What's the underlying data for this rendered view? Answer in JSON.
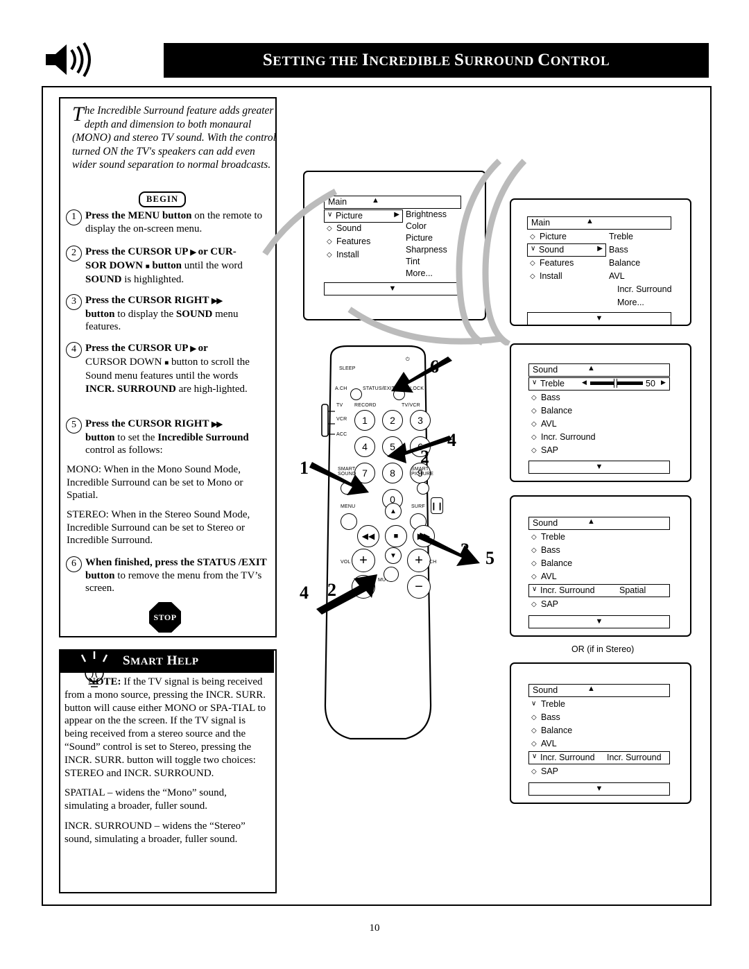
{
  "header": {
    "title_main": "SETTING THE INCREDIBLE SURROUND CONTROL",
    "speaker_icon": "speaker-icon"
  },
  "intro": {
    "dropcap": "T",
    "text": "he Incredible Surround feature adds greater depth and dimension to both monaural (MONO) and stereo TV sound. With the control turned ON the TV's speakers can add even wider sound separation to normal broadcasts."
  },
  "begin_label": "BEGIN",
  "stop_label": "STOP",
  "steps": [
    {
      "num": "1",
      "html": "<b>Press the MENU button</b> on the remote to display the on-screen menu."
    },
    {
      "num": "2",
      "html": "<b>Press the CURSOR UP ▶ or CUR-SOR DOWN ■ button</b> until the word <b>SOUND</b> is highlighted."
    },
    {
      "num": "3",
      "html": "<b>Press the CURSOR RIGHT ▶▶ button</b> to display the <b>SOUND</b> menu features."
    },
    {
      "num": "4",
      "html": "<b>Press the CURSOR UP ▶ or</b> CURSOR DOWN ■ button to scroll the Sound menu features until the words <b>INCR. SURROUND</b> are high-lighted."
    },
    {
      "num": "5",
      "html": "<b>Press the CURSOR RIGHT ▶▶ button</b> to set the <b>Incredible Surround</b> control as follows:"
    },
    {
      "num": "6",
      "html": "<b>When finished, press the STATUS /EXIT button</b> to remove the menu from the TV’s screen."
    }
  ],
  "paragraphs": [
    "MONO: When in the Mono Sound Mode, Incredible Surround can be set to Mono or Spatial.",
    "STEREO: When in the Stereo Sound Mode, Incredible Surround can be set to Stereo or Incredible Surround."
  ],
  "smart_help": {
    "title": "SMART HELP",
    "bulb_icon": "lightbulb-icon",
    "note_label": "NOTE:",
    "note": "If the TV signal is being received from a mono source, pressing the INCR. SURR. button will cause either MONO or SPA-TIAL to appear on the the screen. If the TV signal is being received from a stereo source and the “Sound” control is set to Stereo, pressing the INCR. SURR. button will toggle two choices: STEREO and  INCR. SURROUND.",
    "spatial": "SPATIAL – widens the “Mono” sound, simulating a broader, fuller sound.",
    "incr": "INCR. SURROUND – widens the “Stereo” sound, simulating a broader, fuller sound."
  },
  "osd": {
    "main_tv": {
      "title": "Main",
      "items": [
        {
          "mark": "check",
          "name": "Picture",
          "arrow": true
        },
        {
          "mark": "diamond",
          "name": "Sound"
        },
        {
          "mark": "diamond",
          "name": "Features"
        },
        {
          "mark": "diamond",
          "name": "Install"
        }
      ],
      "right_col": [
        "Brightness",
        "Color",
        "Picture",
        "Sharpness",
        "Tint",
        "More..."
      ]
    },
    "main_right": {
      "title": "Main",
      "items": [
        {
          "mark": "diamond",
          "name": "Picture"
        },
        {
          "mark": "check",
          "name": "Sound",
          "arrow": true
        },
        {
          "mark": "diamond",
          "name": "Features"
        },
        {
          "mark": "diamond",
          "name": "Install"
        }
      ],
      "right_col": [
        "Treble",
        "Bass",
        "Balance",
        "AVL",
        "Incr. Surround",
        "More..."
      ]
    },
    "sound_treble": {
      "title": "Sound",
      "items": [
        {
          "mark": "check",
          "name": "Treble",
          "slider": true,
          "value": "50"
        },
        {
          "mark": "diamond",
          "name": "Bass"
        },
        {
          "mark": "diamond",
          "name": "Balance"
        },
        {
          "mark": "diamond",
          "name": "AVL"
        },
        {
          "mark": "diamond",
          "name": "Incr. Surround"
        },
        {
          "mark": "diamond",
          "name": "SAP"
        }
      ]
    },
    "sound_spatial": {
      "title": "Sound",
      "items": [
        {
          "mark": "diamond",
          "name": "Treble"
        },
        {
          "mark": "diamond",
          "name": "Bass"
        },
        {
          "mark": "diamond",
          "name": "Balance"
        },
        {
          "mark": "diamond",
          "name": "AVL"
        },
        {
          "mark": "check",
          "name": "Incr. Surround",
          "value": "Spatial",
          "boxed": true
        },
        {
          "mark": "diamond",
          "name": "SAP"
        }
      ]
    },
    "sound_incr": {
      "title": "Sound",
      "items": [
        {
          "mark": "check",
          "name": "Treble"
        },
        {
          "mark": "diamond",
          "name": "Bass"
        },
        {
          "mark": "diamond",
          "name": "Balance"
        },
        {
          "mark": "diamond",
          "name": "AVL"
        },
        {
          "mark": "check",
          "name": "Incr. Surround",
          "value": "Incr. Surround",
          "boxed": true
        },
        {
          "mark": "diamond",
          "name": "SAP"
        }
      ]
    },
    "or_caption": "OR (if in Stereo)"
  },
  "remote": {
    "labels": [
      "SLEEP",
      "A.CH",
      "STATUS/EXIT",
      "CLOCK",
      "TV",
      "RECORD",
      "TV/VCR",
      "VCR",
      "ACC",
      "SMART SOUND",
      "SMART PICTURE",
      "MENU",
      "SURF",
      "VOL",
      "CH",
      "MUTE"
    ],
    "keys": [
      "1",
      "2",
      "3",
      "4",
      "5",
      "6",
      "7",
      "8",
      "9",
      "0"
    ]
  },
  "callouts": [
    "1",
    "2",
    "3",
    "4",
    "5",
    "6",
    "2",
    "4",
    "5",
    "6"
  ],
  "page_number": "10"
}
